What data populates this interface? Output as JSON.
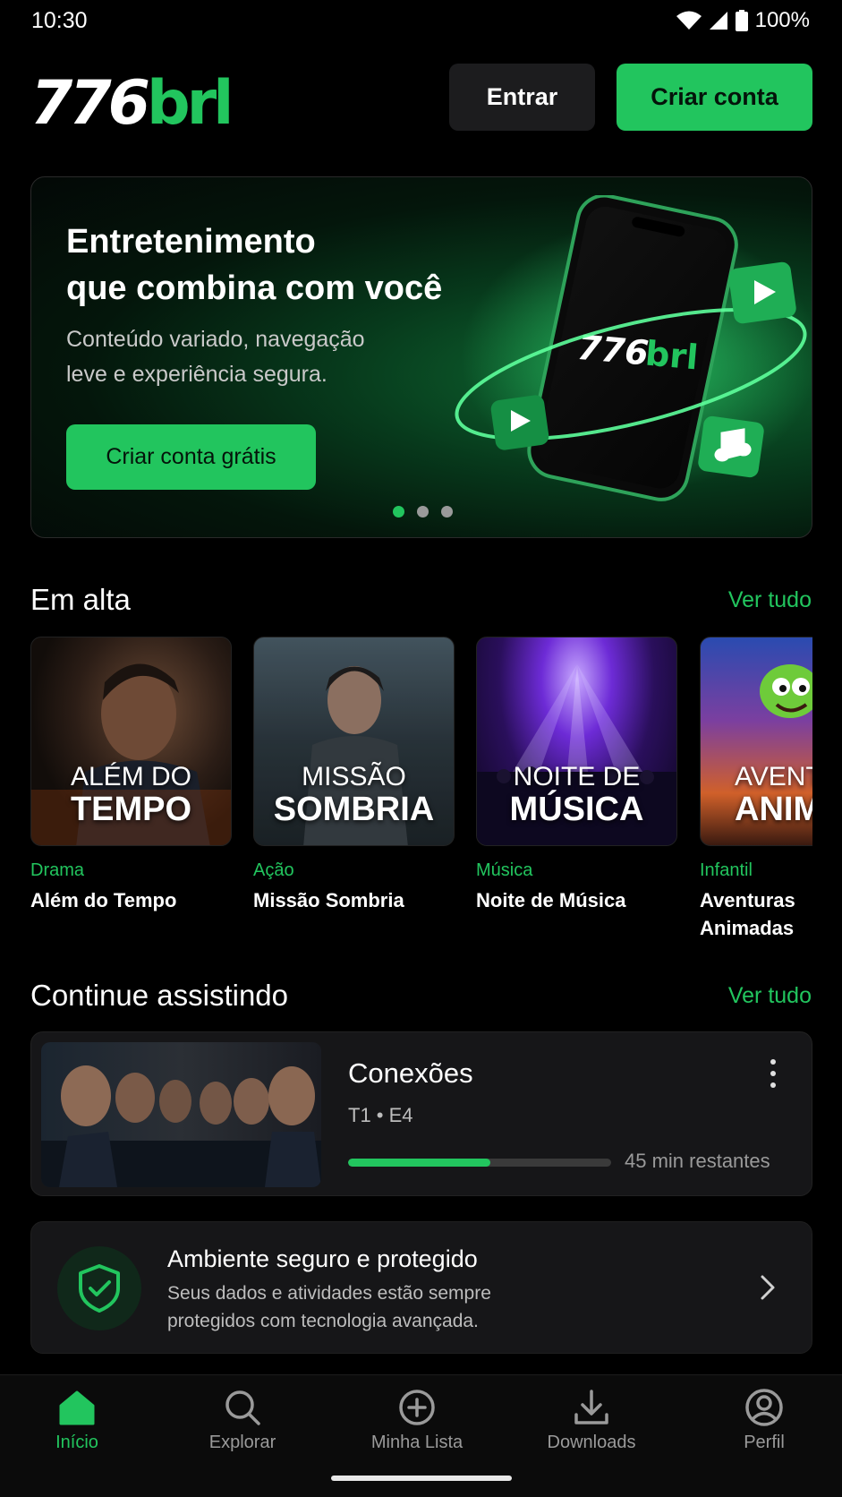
{
  "status_bar": {
    "time": "10:30",
    "battery": "100%"
  },
  "header": {
    "logo_number": "776",
    "logo_suffix": "brl",
    "login_label": "Entrar",
    "signup_label": "Criar conta"
  },
  "hero": {
    "title_line1": "Entretenimento",
    "title_line2": "que combina com você",
    "subtitle_line1": "Conteúdo variado, navegação",
    "subtitle_line2": "leve e experiência segura.",
    "cta_label": "Criar conta grátis",
    "phone_logo_number": "776",
    "phone_logo_suffix": "brl",
    "slides": 3,
    "active_slide": 1
  },
  "trending": {
    "title": "Em alta",
    "see_all": "Ver tudo",
    "items": [
      {
        "genre": "Drama",
        "title": "Além do Tempo",
        "poster_line1": "ALÉM DO",
        "poster_line2": "TEMPO"
      },
      {
        "genre": "Ação",
        "title": "Missão Sombria",
        "poster_line1": "MISSÃO",
        "poster_line2": "SOMBRIA"
      },
      {
        "genre": "Música",
        "title": "Noite de Música",
        "poster_line1": "NOITE DE",
        "poster_line2": "MÚSICA"
      },
      {
        "genre": "Infantil",
        "title": "Aventuras Animadas",
        "poster_line1": "AVENT",
        "poster_line2": "ANIM"
      }
    ]
  },
  "continue_watching": {
    "title": "Continue assistindo",
    "see_all": "Ver tudo",
    "item": {
      "title": "Conexões",
      "episode": "T1 • E4",
      "progress": 0.54,
      "remaining": "45 min restantes"
    }
  },
  "secure": {
    "title": "Ambiente seguro e protegido",
    "desc_line1": "Seus dados e atividades estão sempre",
    "desc_line2": "protegidos com tecnologia avançada."
  },
  "nav": {
    "items": [
      {
        "label": "Início",
        "icon": "home-icon",
        "active": true
      },
      {
        "label": "Explorar",
        "icon": "search-icon",
        "active": false
      },
      {
        "label": "Minha Lista",
        "icon": "plus-circle-icon",
        "active": false
      },
      {
        "label": "Downloads",
        "icon": "download-icon",
        "active": false
      },
      {
        "label": "Perfil",
        "icon": "profile-icon",
        "active": false
      }
    ]
  },
  "colors": {
    "accent": "#22c55e",
    "background": "#000000",
    "surface": "#161618"
  }
}
